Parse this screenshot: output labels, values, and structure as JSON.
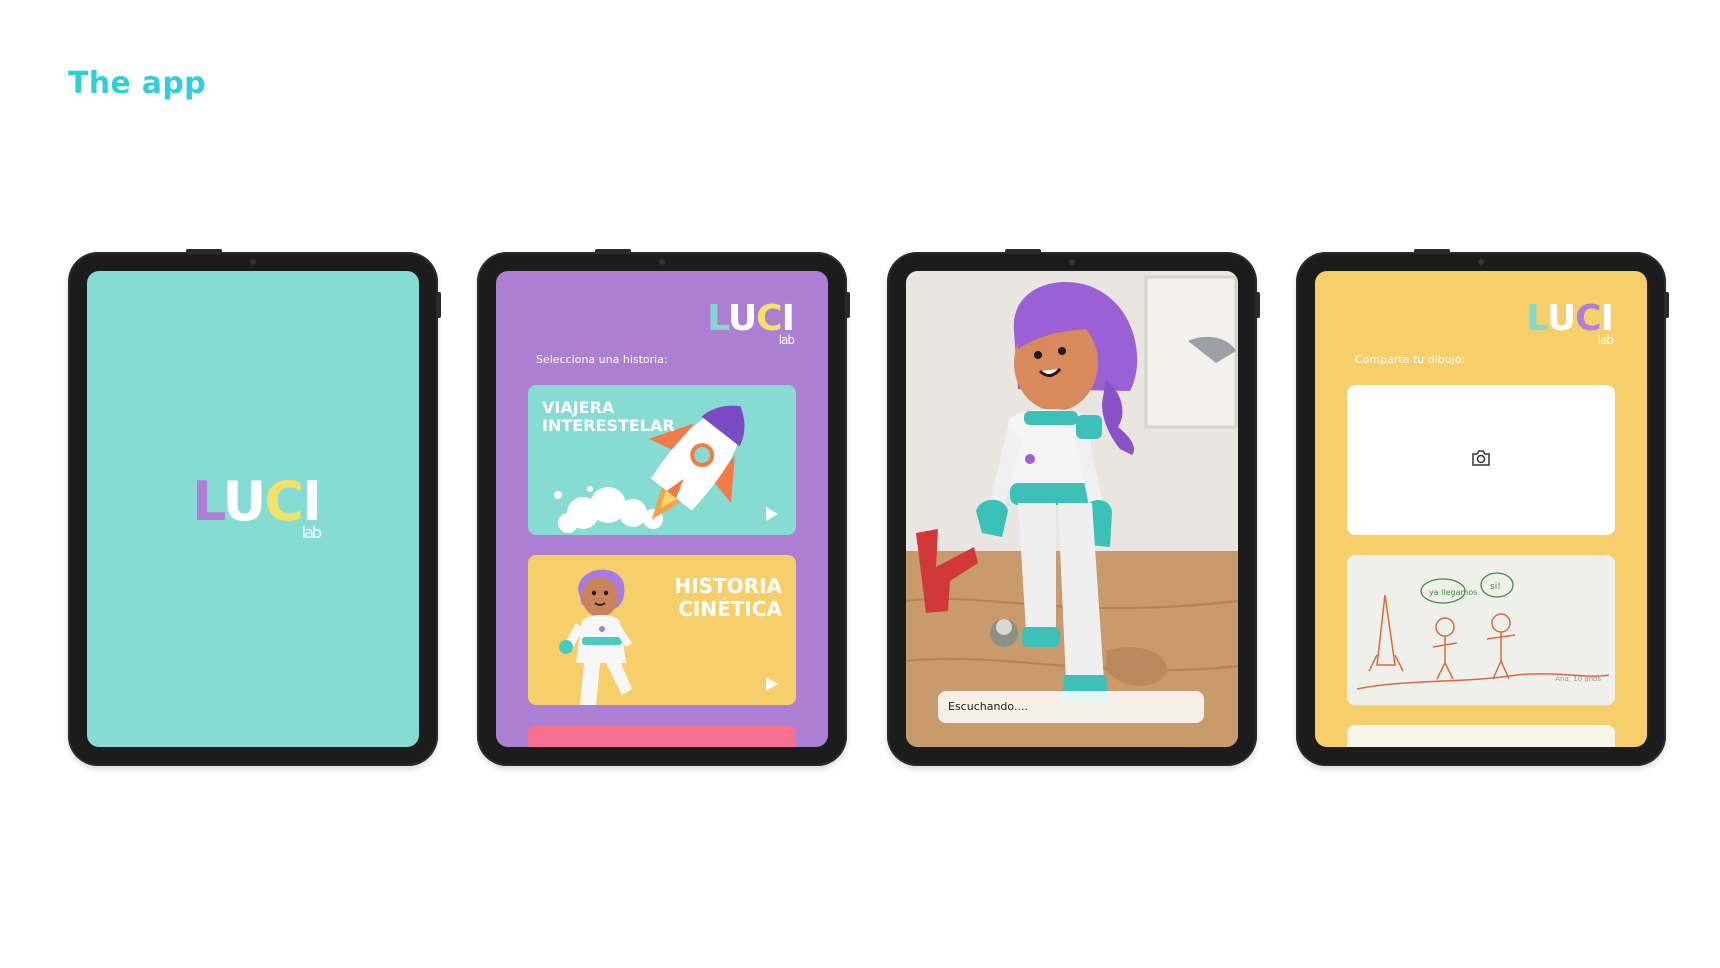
{
  "page": {
    "title": "The app"
  },
  "logo": {
    "letters": [
      "L",
      "U",
      "C",
      "I"
    ],
    "sub": "lab"
  },
  "story_screen": {
    "prompt": "Selecciona una historia:",
    "cards": [
      {
        "title_line1": "VIAJERA",
        "title_line2": "INTERESTELAR",
        "color": "#86dbd3"
      },
      {
        "title_line1": "HISTORIA",
        "title_line2": "CINÉTICA",
        "color": "#f6cf6b"
      },
      {
        "color": "#f6708f"
      }
    ]
  },
  "ar_screen": {
    "status": "Escuchando...."
  },
  "share_screen": {
    "prompt": "Comparte tu dibujo:",
    "upload_icon": "camera-icon",
    "drawing_caption": "Ana, 10 años",
    "drawing_bubble_1": "ya llegamos",
    "drawing_bubble_2": "si!"
  },
  "colors": {
    "title": "#2ed0d8",
    "teal": "#86dbd3",
    "purple": "#ad7fd3",
    "yellow": "#f6cf6b",
    "pink": "#f6708f",
    "tablet_frame": "#1c1c1c"
  }
}
